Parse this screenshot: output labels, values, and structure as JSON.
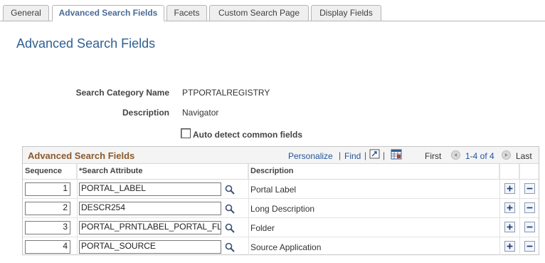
{
  "tabs": [
    {
      "label": "General"
    },
    {
      "label": "Advanced Search Fields"
    },
    {
      "label": "Facets"
    },
    {
      "label": "Custom Search Page"
    },
    {
      "label": "Display Fields"
    }
  ],
  "page_title": "Advanced Search Fields",
  "form": {
    "category_label": "Search Category Name",
    "category_value": "PTPORTALREGISTRY",
    "description_label": "Description",
    "description_value": "Navigator",
    "auto_detect_label": "Auto detect common fields",
    "auto_detect_checked": false
  },
  "grid": {
    "title": "Advanced Search Fields",
    "personalize": "Personalize",
    "find": "Find",
    "sep": "|",
    "first": "First",
    "range": "1-4 of 4",
    "last": "Last",
    "columns": {
      "sequence": "Sequence",
      "attribute": "*Search Attribute",
      "description": "Description"
    },
    "rows": [
      {
        "sequence": "1",
        "attribute": "PORTAL_LABEL",
        "description": "Portal Label"
      },
      {
        "sequence": "2",
        "attribute": "DESCR254",
        "description": "Long Description"
      },
      {
        "sequence": "3",
        "attribute": "PORTAL_PRNTLABEL_PORTAL_FL",
        "description": "Folder"
      },
      {
        "sequence": "4",
        "attribute": "PORTAL_SOURCE",
        "description": "Source Application"
      }
    ]
  },
  "icons": {
    "lookup": "magnifier-icon",
    "zoom": "zoom-icon",
    "download": "spreadsheet-icon",
    "add": "plus-icon",
    "delete": "minus-icon",
    "prev": "triangle-left-icon",
    "next": "triangle-right-icon"
  },
  "colors": {
    "title": "#2f5f91",
    "grid_title": "#8b5a2b",
    "link": "#23559a"
  }
}
